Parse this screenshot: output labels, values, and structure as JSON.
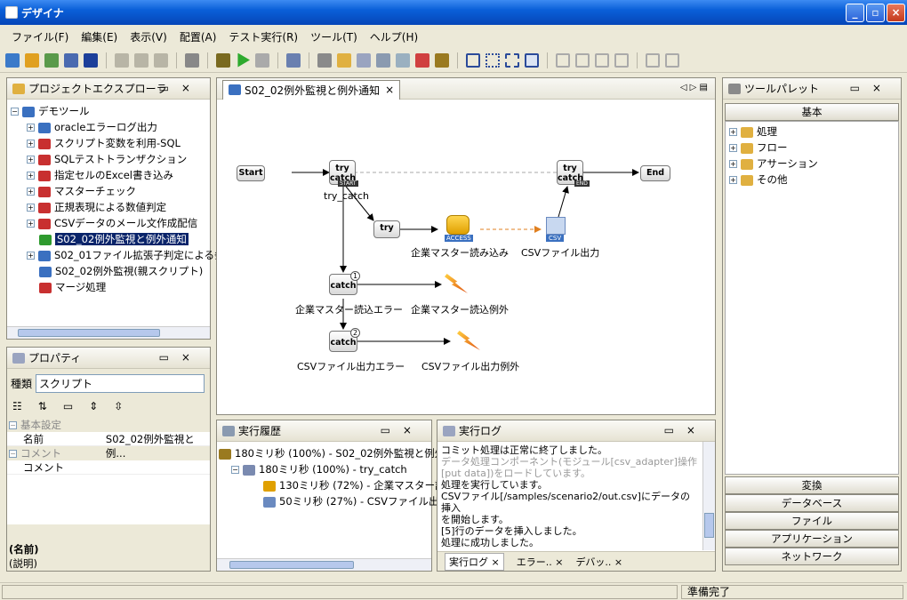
{
  "window": {
    "title": "デザイナ",
    "min": "_",
    "max": "▫",
    "close": "×"
  },
  "menu": [
    "ファイル(F)",
    "編集(E)",
    "表示(V)",
    "配置(A)",
    "テスト実行(R)",
    "ツール(T)",
    "ヘルプ(H)"
  ],
  "explorer": {
    "title": "プロジェクトエクスプローラ",
    "root": "デモツール",
    "items": [
      {
        "label": "oracleエラーログ出力",
        "exp": "+"
      },
      {
        "label": "スクリプト変数を利用-SQL",
        "exp": "+"
      },
      {
        "label": "SQLテストトランザクション",
        "exp": "+"
      },
      {
        "label": "指定セルのExcel書き込み",
        "exp": "+"
      },
      {
        "label": "マスターチェック",
        "exp": "+"
      },
      {
        "label": "正規表現による数値判定",
        "exp": "+"
      },
      {
        "label": "CSVデータのメール文作成配信",
        "exp": "+"
      },
      {
        "label": "S02_02例外監視と例外通知",
        "exp": ""
      },
      {
        "label": "S02_01ファイル拡張子判定による条",
        "exp": "+"
      },
      {
        "label": "S02_02例外監視(親スクリプト)",
        "exp": ""
      },
      {
        "label": "マージ処理",
        "exp": ""
      }
    ]
  },
  "props": {
    "title": "プロパティ",
    "kind_label": "種類",
    "kind_value": "スクリプト",
    "sec1": "基本設定",
    "name_key": "名前",
    "name_val": "S02_02例外監視と例...",
    "sec2": "コメント",
    "comment_key": "コメント",
    "foot1": "(名前)",
    "foot2": "(説明)"
  },
  "editor": {
    "tab": "S02_02例外監視と例外通知",
    "nav": "◁ ▷ ▤"
  },
  "diagram": {
    "start": "Start",
    "end": "End",
    "try": "try",
    "catch": "catch",
    "trycatch": "try_catch",
    "start_badge": "START",
    "end_badge": "END",
    "read": "企業マスター読み込み",
    "csv": "CSVファイル出力",
    "access": "ACCESS",
    "csvb": "CSV",
    "err1": "企業マスター読込エラー",
    "exc1": "企業マスター読込例外",
    "err2": "CSVファイル出力エラー",
    "exc2": "CSVファイル出力例外",
    "n1": "1",
    "n2": "2"
  },
  "history": {
    "title": "実行履歴",
    "rows": [
      "180ミリ秒 (100%) - S02_02例外監視と例外",
      "180ミリ秒 (100%) - try_catch",
      "130ミリ秒 (72%) - 企業マスター読み",
      "50ミリ秒 (27%) - CSVファイル出力"
    ]
  },
  "log": {
    "title": "実行ログ",
    "lines": [
      "コミット処理は正常に終了しました。",
      "データ処理コンポーネント(モジュール[csv_adapter]操作",
      "[put data])をロードしています。",
      "処理を実行しています。",
      "CSVファイル[/samples/scenario2/out.csv]にデータの挿入",
      "を開始します。",
      "[5]行のデータを挿入しました。",
      "処理に成功しました。"
    ],
    "tabs": [
      "実行ログ",
      "エラー..",
      "デバッ.."
    ]
  },
  "palette": {
    "title": "ツールパレット",
    "basic": "基本",
    "items": [
      "処理",
      "フロー",
      "アサーション",
      "その他"
    ],
    "cats": [
      "変換",
      "データベース",
      "ファイル",
      "アプリケーション",
      "ネットワーク"
    ]
  },
  "status": "準備完了"
}
